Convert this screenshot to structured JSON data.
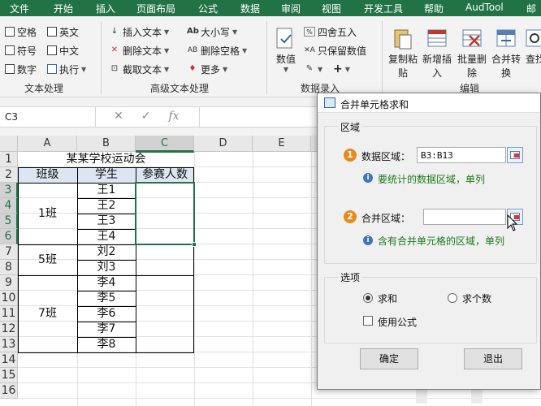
{
  "ribbon_tabs": [
    "文件",
    "开始",
    "插入",
    "页面布局",
    "公式",
    "数据",
    "审阅",
    "视图",
    "开发工具",
    "帮助",
    "AudTool",
    "邮"
  ],
  "ribbon": {
    "text_group": {
      "label": "文本处理",
      "items": [
        "空格",
        "英文",
        "符号",
        "中文",
        "数字",
        "执行"
      ]
    },
    "advanced_group": {
      "label": "高级文本处理",
      "items": [
        "插入文本",
        "大小写",
        "删除文本",
        "删除空格",
        "截取文本",
        "更多"
      ]
    },
    "entry_group": {
      "label": "数据录入",
      "value_button": "数值",
      "round_label": "四舍五入",
      "keep_value_label": "只保留数值"
    },
    "edit_group": {
      "label": "编辑",
      "buttons": [
        "复制粘贴",
        "新增插入",
        "批量删除",
        "合并转换",
        "查找"
      ]
    }
  },
  "formula_bar": {
    "name_box": "C3",
    "cancel_icon": "✕",
    "confirm_icon": "✓",
    "fx_icon": "fx",
    "formula": ""
  },
  "sheet": {
    "columns": [
      "A",
      "B",
      "C",
      "D",
      "E"
    ],
    "rows": [
      "1",
      "2",
      "3",
      "4",
      "5",
      "6",
      "7",
      "8",
      "9",
      "10",
      "11",
      "12",
      "13",
      "14",
      "15",
      "16"
    ],
    "title": "某某学校运动会",
    "headers": [
      "班级",
      "学生",
      "参赛人数"
    ],
    "classes": [
      "1班",
      "5班",
      "7班"
    ],
    "students": [
      "王1",
      "王2",
      "王3",
      "王4",
      "刘2",
      "刘3",
      "李4",
      "李5",
      "李6",
      "李7",
      "李8"
    ]
  },
  "dialog": {
    "title": "合并单元格求和",
    "area_label": "区域",
    "data_label": "数据区域：",
    "data_value": "B3:B13",
    "data_hint": "要统计的数据区域，单列",
    "merge_label": "合并区域：",
    "merge_value": "",
    "merge_hint": "含有合并单元格的区域，单列",
    "options_label": "选项",
    "opt_sum": "求和",
    "opt_count": "求个数",
    "opt_formula": "使用公式",
    "ok": "确定",
    "exit": "退出",
    "step1": "1",
    "step2": "2",
    "info": "i"
  }
}
